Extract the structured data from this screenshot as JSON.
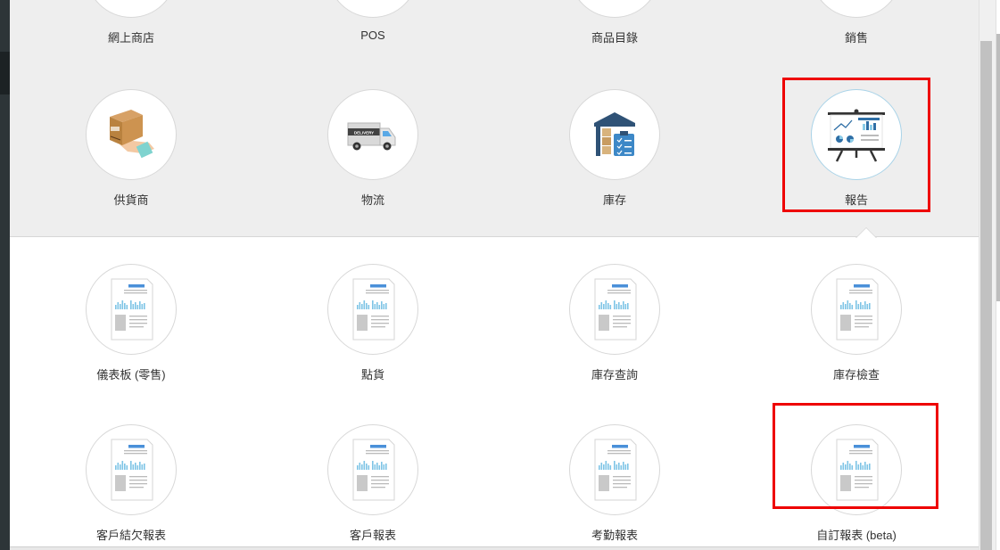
{
  "modules": {
    "top_row": [
      "網上商店",
      "POS",
      "商品目錄",
      "銷售"
    ],
    "second_row": [
      "供貨商",
      "物流",
      "庫存",
      "報告"
    ],
    "truck_text": "DELIVERY"
  },
  "reports": {
    "row1": [
      "儀表板 (零售)",
      "點貨",
      "庫存查詢",
      "庫存檢查"
    ],
    "row2": [
      "客戶結欠報表",
      "客戶報表",
      "考勤報表",
      "自訂報表 (beta)"
    ]
  },
  "colors": {
    "highlight": "#ee0000",
    "panel_bg": "#eeeeee",
    "report_accent": "#4a90d9",
    "chart_bars": "#7ec4e6"
  }
}
